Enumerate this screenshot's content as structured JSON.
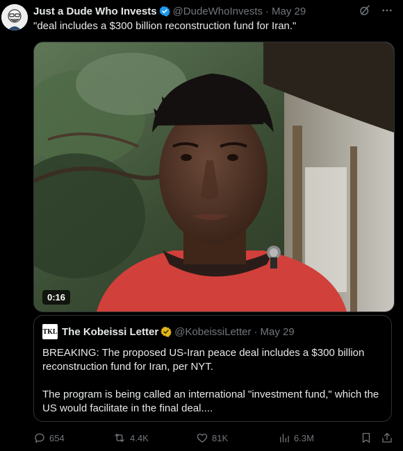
{
  "author": {
    "display_name": "Just a Dude Who Invests",
    "handle": "@DudeWhoInvests",
    "separator": "·",
    "date": "May 29",
    "verified_color": "#1d9bf0"
  },
  "tweet_text": "\"deal includes a $300 billion reconstruction fund for Iran.\"",
  "media": {
    "type": "video",
    "duration": "0:16"
  },
  "quote": {
    "avatar_text": "TKL",
    "display_name": "The Kobeissi Letter",
    "handle": "@KobeissiLetter",
    "separator": "·",
    "date": "May 29",
    "badge_color": "#e2b719",
    "paragraph_1": "BREAKING: The proposed US-Iran peace deal includes a $300 billion reconstruction fund for Iran, per NYT.",
    "paragraph_2": "The program is being called an international \"investment fund,\" which the US would facilitate in the final deal...."
  },
  "actions": {
    "replies": "654",
    "reposts": "4.4K",
    "likes": "81K",
    "views": "6.3M"
  },
  "icons": [
    "grok-icon",
    "more-icon",
    "reply-icon",
    "repost-icon",
    "like-icon",
    "views-icon",
    "bookmark-icon",
    "share-icon",
    "verified-icon",
    "gold-verified-icon",
    "play-duration-badge"
  ],
  "colors": {
    "background": "#000000",
    "text_primary": "#e7e9ea",
    "text_secondary": "#71767b",
    "border": "#2f3336"
  }
}
